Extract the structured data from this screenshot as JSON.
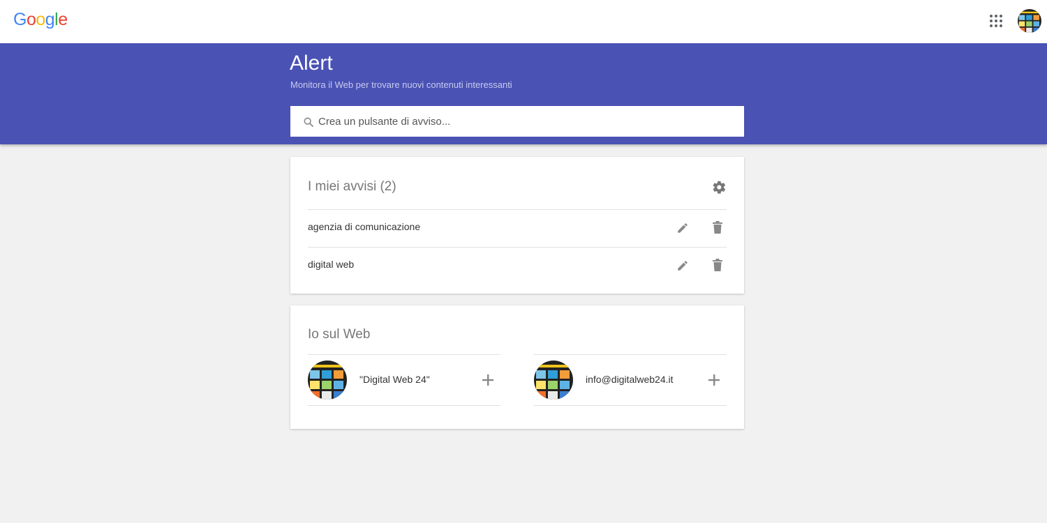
{
  "brand": {
    "letters": [
      {
        "char": "G",
        "color": "#4285f4"
      },
      {
        "char": "o",
        "color": "#ea4335"
      },
      {
        "char": "o",
        "color": "#fbbc05"
      },
      {
        "char": "g",
        "color": "#4285f4"
      },
      {
        "char": "l",
        "color": "#34a853"
      },
      {
        "char": "e",
        "color": "#ea4335"
      }
    ]
  },
  "topbar": {
    "apps_icon": "apps-grid-icon",
    "account_icon": "account-avatar"
  },
  "header": {
    "title": "Alert",
    "subtitle": "Monitora il Web per trovare nuovi contenuti interessanti",
    "background": "#4a52b4"
  },
  "search": {
    "icon": "search-icon",
    "placeholder": "Crea un pulsante di avviso..."
  },
  "alerts_card": {
    "title": "I miei avvisi (2)",
    "settings_icon": "gear-icon",
    "items": [
      {
        "label": "agenzia di comunicazione",
        "edit_icon": "pencil-icon",
        "delete_icon": "trash-icon"
      },
      {
        "label": "digital web",
        "edit_icon": "pencil-icon",
        "delete_icon": "trash-icon"
      }
    ]
  },
  "web_card": {
    "title": "Io sul Web",
    "items": [
      {
        "label": "\"Digital Web 24\"",
        "action_icon": "plus-icon"
      },
      {
        "label": "info@digitalweb24.it",
        "action_icon": "plus-icon"
      }
    ]
  }
}
